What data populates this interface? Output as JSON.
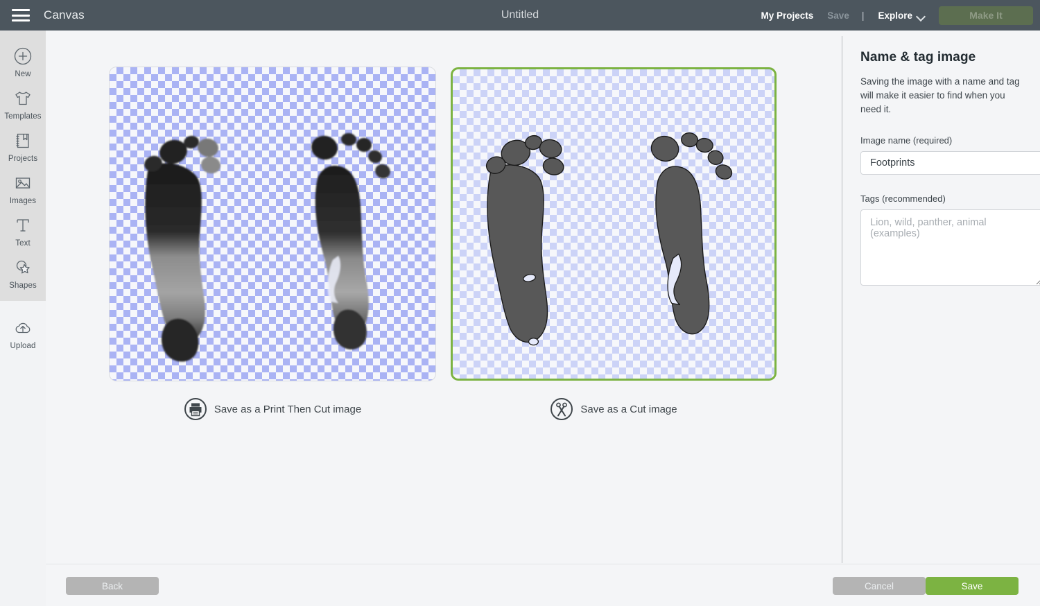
{
  "topbar": {
    "menu_icon": "hamburger-icon",
    "app_title": "Canvas",
    "doc_title": "Untitled",
    "my_projects": "My Projects",
    "save": "Save",
    "separator": "|",
    "explore": "Explore",
    "explore_chevron": "chevron-down-icon",
    "make_it": "Make It",
    "bg_color": "#4c565e",
    "make_it_color": "#5c6e50"
  },
  "sidebar": {
    "items": [
      {
        "label": "New",
        "icon": "plus-circle-icon"
      },
      {
        "label": "Templates",
        "icon": "tshirt-icon"
      },
      {
        "label": "Projects",
        "icon": "book-bookmark-icon"
      },
      {
        "label": "Images",
        "icon": "picture-icon"
      },
      {
        "label": "Text",
        "icon": "text-t-icon"
      },
      {
        "label": "Shapes",
        "icon": "shapes-star-icon"
      }
    ],
    "upload": {
      "label": "Upload",
      "icon": "cloud-upload-icon"
    }
  },
  "canvas": {
    "options": [
      {
        "id": "print-then-cut",
        "label": "Save as a Print Then Cut image",
        "icon": "printer-circle-icon",
        "selected": false,
        "preview_style": "photographic",
        "checker_colors": [
          "#aab3f4",
          "#f6f7fb"
        ]
      },
      {
        "id": "cut",
        "label": "Save as a Cut image",
        "icon": "scissors-circle-icon",
        "selected": true,
        "preview_style": "silhouette",
        "checker_colors": [
          "#ccd3f7",
          "#f6f7fb"
        ],
        "silhouette_color": "#585858",
        "selection_border_color": "#7cb342"
      }
    ]
  },
  "panel": {
    "title": "Name & tag image",
    "description": "Saving the image with a name and tag will make it easier to find when you need it.",
    "name_label": "Image name (required)",
    "name_value": "Footprints",
    "name_placeholder": "",
    "tags_label": "Tags (recommended)",
    "tags_value": "",
    "tags_placeholder": "Lion, wild, panther, animal (examples)"
  },
  "bottombar": {
    "back": "Back",
    "cancel": "Cancel",
    "save": "Save",
    "save_color": "#7cb342",
    "disabled_color": "#b4b4b4"
  }
}
